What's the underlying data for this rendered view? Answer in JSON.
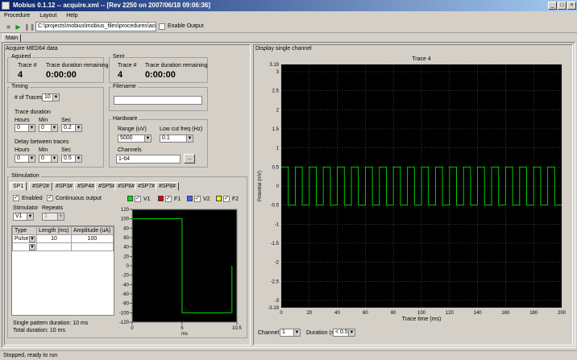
{
  "window": {
    "title": "Mobius 0.1.12 -- acquire.xml -- [Rev 2250 on 2007/06/18 09:06:36]"
  },
  "menu": [
    "Procedure",
    "Layout",
    "Help"
  ],
  "toolbar": {
    "path": "C:\\projects\\mobius\\mobius_files\\procedures\\acquire",
    "enable_output_label": "Enable Output",
    "icons": [
      "stop-icon",
      "play-icon",
      "pause-icon"
    ]
  },
  "tabs": {
    "main": "Main"
  },
  "acquire": {
    "title": "Acquire MED64 data",
    "aquired": {
      "label": "Aquired",
      "trace_label": "Trace #",
      "trace_value": "4",
      "remaining_label": "Trace duration remaining",
      "remaining_value": "0:00:00"
    },
    "sent": {
      "label": "Sent",
      "trace_label": "Trace #",
      "trace_value": "4",
      "remaining_label": "Trace duration remaining",
      "remaining_value": "0:00:00"
    },
    "timing": {
      "label": "Timing",
      "num_traces_label": "# of Traces",
      "num_traces": "10",
      "trace_duration_label": "Trace duration",
      "hours_label": "Hours",
      "min_label": "Min",
      "sec_label": "Sec",
      "trace_hours": "0",
      "trace_min": "0",
      "trace_sec": "0.2",
      "delay_label": "Delay between traces",
      "delay_hours": "0",
      "delay_min": "0",
      "delay_sec": "0.5"
    },
    "filename": {
      "label": "Filename",
      "value": ""
    },
    "hardware": {
      "label": "Hardware",
      "range_label": "Range (uV)",
      "range_value": "5000",
      "lowcut_label": "Low cut freq (Hz)",
      "lowcut_value": "0.1",
      "channels_label": "Channels",
      "channels_value": "1-64",
      "browse_label": "..."
    }
  },
  "stimulation": {
    "label": "Stimulation",
    "tabs": [
      "SP1",
      "#SP2#",
      "#SP3#",
      "#SP4#",
      "#SP5#",
      "#SP6#",
      "#SP7#",
      "#SP8#"
    ],
    "enabled_label": "Enabled",
    "continuous_label": "Continuous output",
    "stimulator_label": "Stimulator",
    "stimulator_value": "V1",
    "repeats_label": "Repeats",
    "repeats_value": "1",
    "legend": [
      {
        "name": "V1",
        "color": "#00e000"
      },
      {
        "name": "F1",
        "color": "#e00000"
      },
      {
        "name": "V2",
        "color": "#4060ff"
      },
      {
        "name": "F2",
        "color": "#ffff00"
      }
    ],
    "table": {
      "headers": [
        "Type",
        "Length (ms)",
        "Amplitude (uA)"
      ],
      "rows": [
        [
          "Pulse",
          "10",
          "100"
        ],
        [
          "",
          "",
          ""
        ]
      ]
    },
    "single_pattern": "Single pattern duration: 10 ms",
    "total_duration": "Total duration: 10 ms"
  },
  "display": {
    "title": "Display single channel",
    "channel_label": "Channel",
    "channel_value": "1",
    "duration_label": "Duration (s)",
    "duration_value": "< 0.5"
  },
  "status": "Stopped, ready to run",
  "chart_data": [
    {
      "type": "line",
      "title": "",
      "xlabel": "ms",
      "ylabel": "",
      "xlim": [
        0,
        10.5
      ],
      "ylim": [
        -120,
        120
      ],
      "xticks": [
        0,
        5,
        10.5
      ],
      "xtick_labels": [
        "0",
        "5",
        "10.5"
      ],
      "yticks": [
        -120,
        -100,
        -80,
        -60,
        -40,
        -20,
        0,
        20,
        40,
        60,
        80,
        100,
        120
      ],
      "series": [
        {
          "name": "V1",
          "color": "#00e000",
          "x": [
            0,
            5,
            5,
            10,
            10
          ],
          "y": [
            100,
            100,
            -100,
            -100,
            0
          ]
        }
      ]
    },
    {
      "type": "line",
      "title": "Trace 4",
      "xlabel": "Trace time (ms)",
      "ylabel": "Potential (mV)",
      "xlim": [
        0,
        200
      ],
      "ylim": [
        -3.19,
        3.19
      ],
      "xticks": [
        0,
        20,
        40,
        60,
        80,
        100,
        120,
        140,
        160,
        180,
        200
      ],
      "yticks": [
        -3.19,
        -3,
        -2.5,
        -2,
        -1.5,
        -1,
        -0.5,
        0,
        0.5,
        1,
        1.5,
        2,
        2.5,
        3,
        3.19
      ],
      "ytick_labels": [
        "-3.19",
        "-3",
        "-2.5",
        "-2",
        "-1.5",
        "-1",
        "-0.5",
        "0",
        "0.5",
        "1",
        "1.5",
        "2",
        "2.5",
        "3",
        "3.19"
      ],
      "series": [
        {
          "color": "#00e000",
          "period_ms": 10,
          "high": 0.5,
          "low": -0.5
        }
      ]
    }
  ]
}
